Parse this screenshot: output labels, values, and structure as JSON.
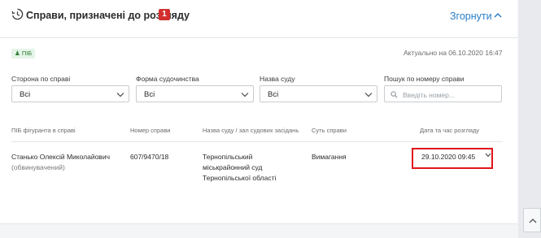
{
  "header": {
    "title": "Справи, призначені до розгляду",
    "badge_count": "1",
    "collapse_label": "Згорнути"
  },
  "filters": {
    "person_tag": "ПІБ",
    "updated_text": "Актуально на 06.10.2020 16:47",
    "side": {
      "label": "Сторона по справі",
      "value": "Всі"
    },
    "form": {
      "label": "Форма судочинства",
      "value": "Всі"
    },
    "court": {
      "label": "Назва суду",
      "value": "Всі"
    },
    "search": {
      "label": "Пошук по номеру справи",
      "placeholder": "Введіть номер..."
    }
  },
  "table": {
    "columns": [
      "ПІБ фігуранта в справі",
      "Номер справи",
      "Назва суду / зал судових засідань",
      "Суть справи",
      "Дата та час розгляду"
    ],
    "rows": [
      {
        "name": "Станько Олексій Миколайович",
        "role": "(обвинувачений)",
        "case_number": "607/9470/18",
        "court_line1": "Тернопільський",
        "court_line2": "міськрайонний суд",
        "court_line3": "Тернопільської області",
        "essence": "Вимагання",
        "datetime": "29.10.2020 09:45"
      }
    ]
  },
  "colors": {
    "accent": "#2a7fc9",
    "badge": "#d32f2f",
    "highlight": "#e0161b",
    "tag_bg": "#e4f4e7",
    "tag_text": "#2e7d32"
  }
}
